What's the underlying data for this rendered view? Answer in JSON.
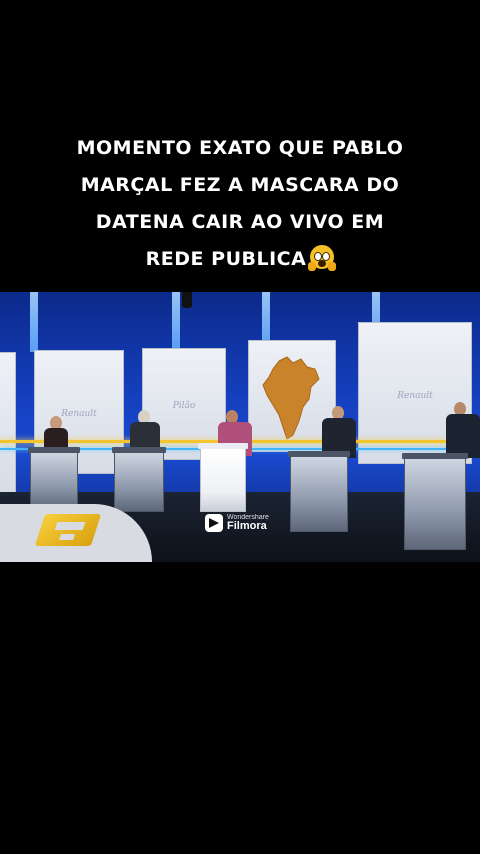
{
  "caption": {
    "lines": [
      "MOMENTO EXATO QUE PABLO",
      "MARÇAL FEZ A MASCARA DO",
      "DATENA CAIR AO VIVO EM",
      "REDE PUBLICA"
    ],
    "emoji": "face-screaming-in-fear-icon"
  },
  "video": {
    "watermark": {
      "brand_small": "Wondershare",
      "brand_big": "Filmora",
      "icon": "filmora-logo-icon"
    },
    "channel_logo": "channel-g-logo",
    "panel_logos": [
      "Renault",
      "Pilão",
      "Renault"
    ],
    "colors": {
      "backdrop_blue": "#1540c0",
      "accent_yellow": "#f2c530",
      "map_orange": "#c9832a"
    }
  }
}
